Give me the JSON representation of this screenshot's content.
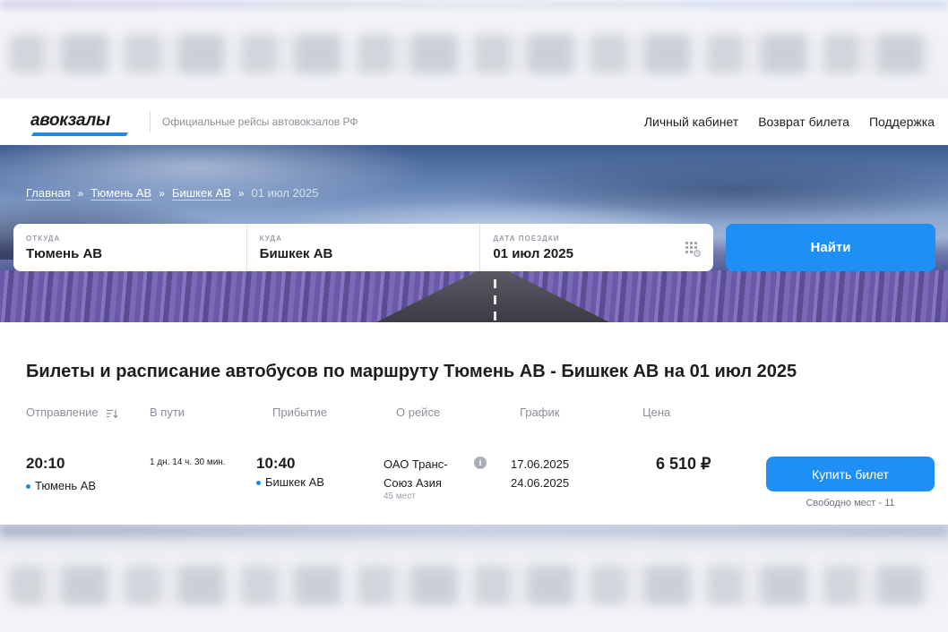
{
  "header": {
    "logo_text": "авокзалы",
    "tagline": "Официальные рейсы автовокзалов РФ",
    "nav": [
      "Личный кабинет",
      "Возврат билета",
      "Поддержка"
    ]
  },
  "breadcrumb": {
    "items": [
      "Главная",
      "Тюмень АВ",
      "Бишкек АВ"
    ],
    "separator": "»",
    "current": "01 июл 2025"
  },
  "search": {
    "from_label": "ОТКУДА",
    "from_value": "Тюмень АВ",
    "to_label": "КУДА",
    "to_value": "Бишкек АВ",
    "date_label": "ДАТА ПОЕЗДКИ",
    "date_value": "01 июл 2025",
    "button_label": "Найти"
  },
  "results": {
    "title": "Билеты и расписание автобусов по маршруту Тюмень АВ - Бишкек АВ на 01 июл 2025",
    "columns": [
      "Отправление",
      "В пути",
      "Прибытие",
      "О рейсе",
      "График",
      "Цена"
    ],
    "trip": {
      "departure_time": "20:10",
      "departure_station": "Тюмень АВ",
      "duration": "1 дн. 14 ч. 30 мин.",
      "arrival_time": "10:40",
      "arrival_station": "Бишкек АВ",
      "carrier_line1": "ОАО Транс-",
      "carrier_line2": "Союз Азия",
      "seats_total": "45 мест",
      "schedule_from": "17.06.2025",
      "schedule_to": "24.06.2025",
      "price": "6 510 ₽",
      "buy_label": "Купить билет",
      "free_seats": "Свободно мест - 11"
    }
  },
  "colors": {
    "accent": "#1e90f5",
    "text": "#1d1d1f",
    "muted": "#8b8f98"
  }
}
